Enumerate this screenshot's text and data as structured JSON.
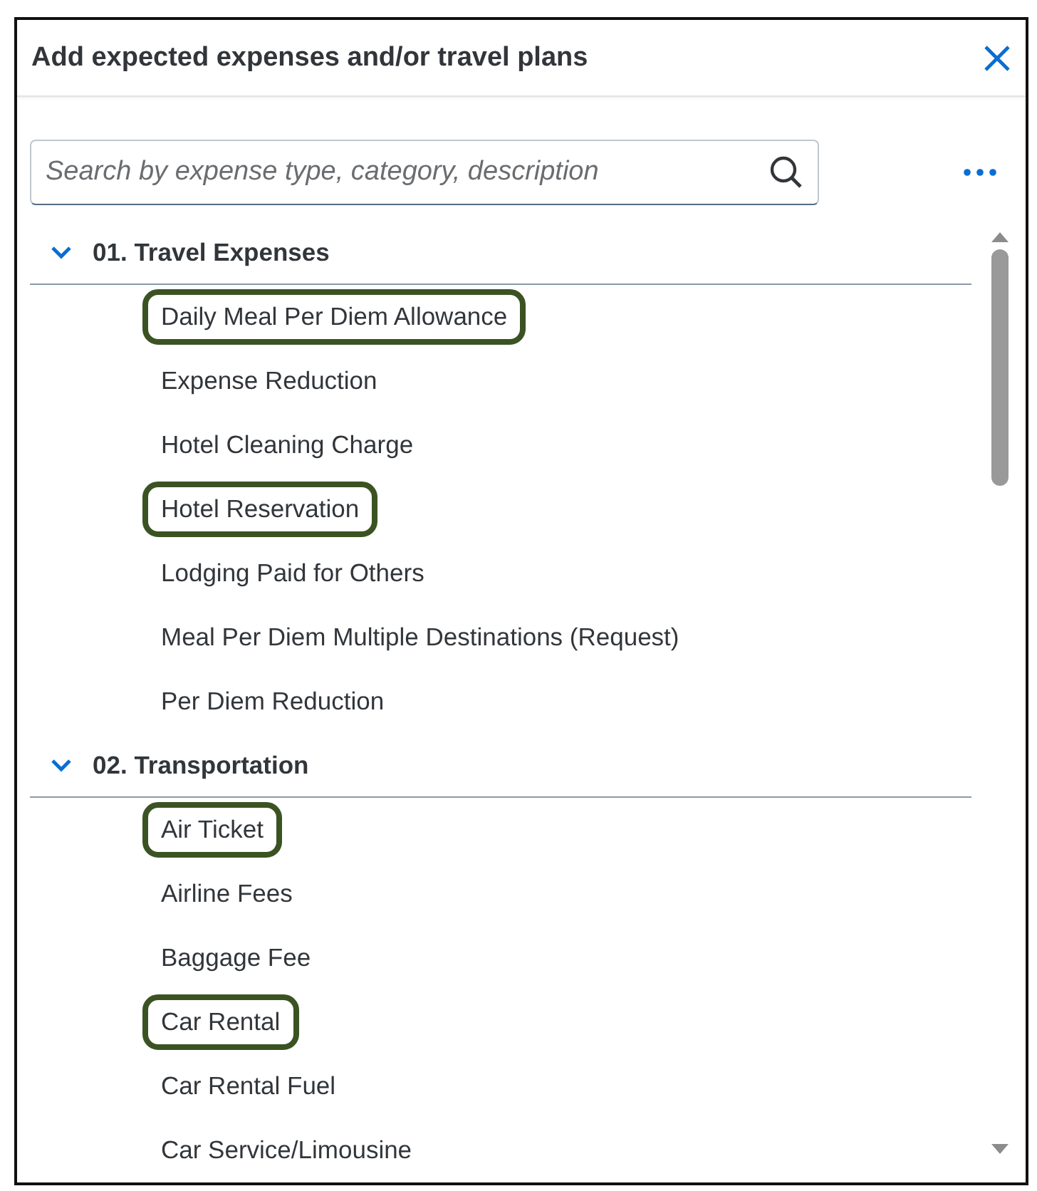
{
  "dialog": {
    "title": "Add expected expenses and/or travel plans"
  },
  "search": {
    "placeholder": "Search by expense type, category, description"
  },
  "groups": [
    {
      "label": "01. Travel Expenses",
      "expanded": true,
      "items": [
        {
          "label": "Daily Meal Per Diem Allowance",
          "highlighted": true
        },
        {
          "label": "Expense Reduction",
          "highlighted": false
        },
        {
          "label": "Hotel Cleaning Charge",
          "highlighted": false
        },
        {
          "label": "Hotel Reservation",
          "highlighted": true
        },
        {
          "label": "Lodging Paid for Others",
          "highlighted": false
        },
        {
          "label": "Meal Per Diem Multiple Destinations (Request)",
          "highlighted": false
        },
        {
          "label": "Per Diem Reduction",
          "highlighted": false
        }
      ]
    },
    {
      "label": "02. Transportation",
      "expanded": true,
      "items": [
        {
          "label": "Air Ticket",
          "highlighted": true
        },
        {
          "label": "Airline Fees",
          "highlighted": false
        },
        {
          "label": "Baggage Fee",
          "highlighted": false
        },
        {
          "label": "Car Rental",
          "highlighted": true
        },
        {
          "label": "Car Rental Fuel",
          "highlighted": false
        },
        {
          "label": "Car Service/Limousine",
          "highlighted": false
        }
      ]
    }
  ]
}
